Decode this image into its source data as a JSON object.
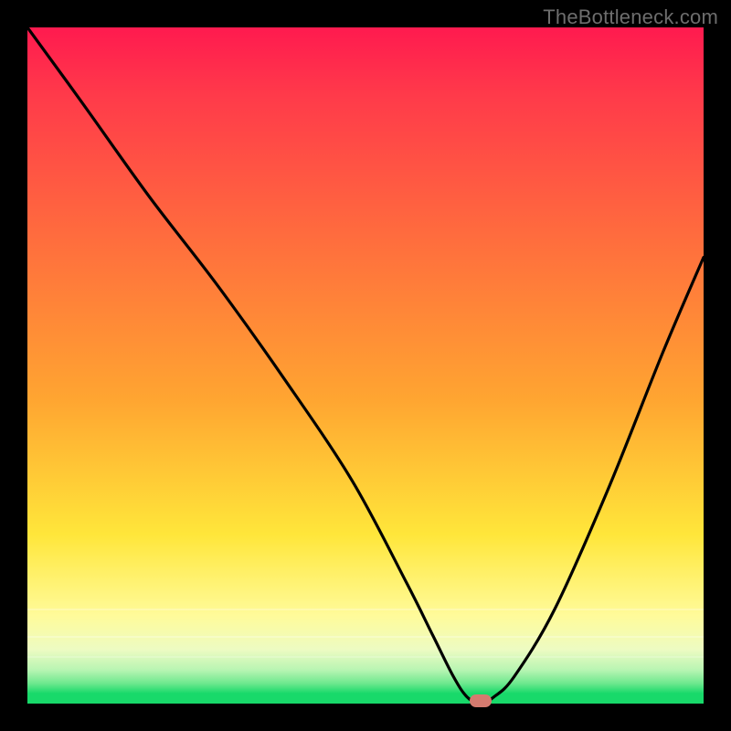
{
  "watermark": "TheBottleneck.com",
  "marker": {
    "color": "#d47a6f"
  },
  "chart_data": {
    "type": "line",
    "title": "",
    "xlabel": "",
    "ylabel": "",
    "xlim": [
      0,
      100
    ],
    "ylim": [
      0,
      100
    ],
    "grid": false,
    "legend": false,
    "note": "x is normalized position along the horizontal axis (0 left, 100 right); y is bottleneck severity where 0 = optimal (green bottom) and 100 = worst (red top). Curve dives from top-left toward a minimum near x≈67 then rises again. Background is a vertical heat gradient red→yellow→green.",
    "series": [
      {
        "name": "bottleneck-curve",
        "x": [
          0,
          8,
          18,
          28,
          38,
          48,
          56,
          60,
          63,
          65,
          67,
          69,
          72,
          78,
          86,
          94,
          100
        ],
        "y": [
          100,
          89,
          75,
          62,
          48,
          33,
          18,
          10,
          4,
          1,
          0,
          1,
          4,
          14,
          32,
          52,
          66
        ]
      }
    ],
    "marker_point": {
      "x": 67,
      "y": 0
    },
    "gradient_stops": [
      {
        "pct": 0,
        "color": "#ff1a4f"
      },
      {
        "pct": 30,
        "color": "#ff6a3e"
      },
      {
        "pct": 55,
        "color": "#ffa531"
      },
      {
        "pct": 75,
        "color": "#ffe63a"
      },
      {
        "pct": 92,
        "color": "#edfbc2"
      },
      {
        "pct": 100,
        "color": "#18d96a"
      }
    ]
  }
}
